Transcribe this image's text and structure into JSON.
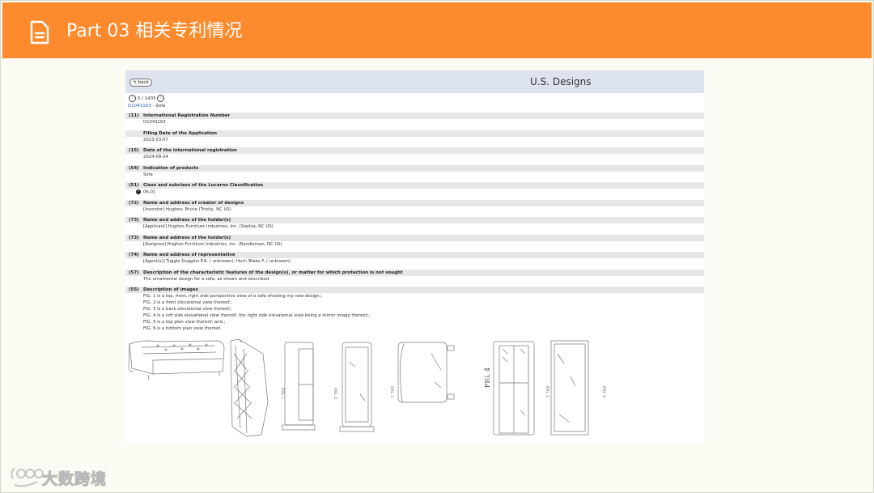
{
  "header": {
    "title": "Part 03  相关专利情况"
  },
  "page": {
    "back_label": "back",
    "site_title": "U.S. Designs",
    "pager": "5 / 1435",
    "doc_link": "D1043163",
    "doc_suffix": " - Sofa"
  },
  "fields": [
    {
      "num": "(11)",
      "label": "International Registration Number",
      "values": [
        "D1043163"
      ]
    },
    {
      "num": "",
      "label": "Filing Date of the Application",
      "values": [
        "2023-03-07"
      ]
    },
    {
      "num": "(15)",
      "label": "Date of the international registration",
      "values": [
        "2024-09-24"
      ]
    },
    {
      "num": "(54)",
      "label": "Indication of products",
      "values": [
        "Sofa"
      ]
    },
    {
      "num": "(51)",
      "label": "Class and subclass of the Locarno Classification",
      "values": [
        "06-01"
      ]
    },
    {
      "num": "(72)",
      "label": "Name and address of creator of designs",
      "values": [
        "[Inventor] Hughes; Bruce (Trinity, NC US)"
      ]
    },
    {
      "num": "(73)",
      "label": "Name and address of the holder(s)",
      "values": [
        "[Applicant]  Hughes Furniture Industries, Inc. (Sophia, NC US)"
      ]
    },
    {
      "num": "(73)",
      "label": "Name and address of the holder(s)",
      "values": [
        "[Assignee]  Hughes Furniture Industries, Inc. (Randleman, NC US)"
      ]
    },
    {
      "num": "(74)",
      "label": "Name and address of representative",
      "values": [
        "[Agent(s)] Tuggle Duggins P.A. ( unknown); Hurt; Blake P. ( unknown)"
      ]
    },
    {
      "num": "(57)",
      "label": "Description of the characteristic features of the design(s), or matter for which protection is not sought",
      "values": [
        "The ornamental design for a sofa, as shown and described."
      ]
    },
    {
      "num": "(55)",
      "label": "Description of images",
      "values": [
        "FIG. 1 is a top, front, right side perspective view of a sofa showing my new design;;",
        "FIG. 2 is a front elevational view thereof;;",
        "FIG. 3 is a back elevational view thereof;;",
        "FIG. 4 is a left side elevational view thereof, the right side elevational view being a mirror image thereof;;",
        "FIG. 5 is a top plan view thereof; and,;",
        "FIG. 6 is a bottom plan view thereof."
      ]
    }
  ],
  "figures": {
    "fig1": "FIG. 1",
    "fig2": "FIG. 2",
    "fig3": "FIG. 3",
    "fig4": "FIG. 4",
    "fig5": "FIG. 5",
    "fig6": "FIG. 6"
  },
  "watermark": {
    "text": "大数跨境"
  },
  "colors": {
    "header": "#fd8a2c",
    "topbar": "#dde3ef",
    "link": "#2b5fb0"
  }
}
